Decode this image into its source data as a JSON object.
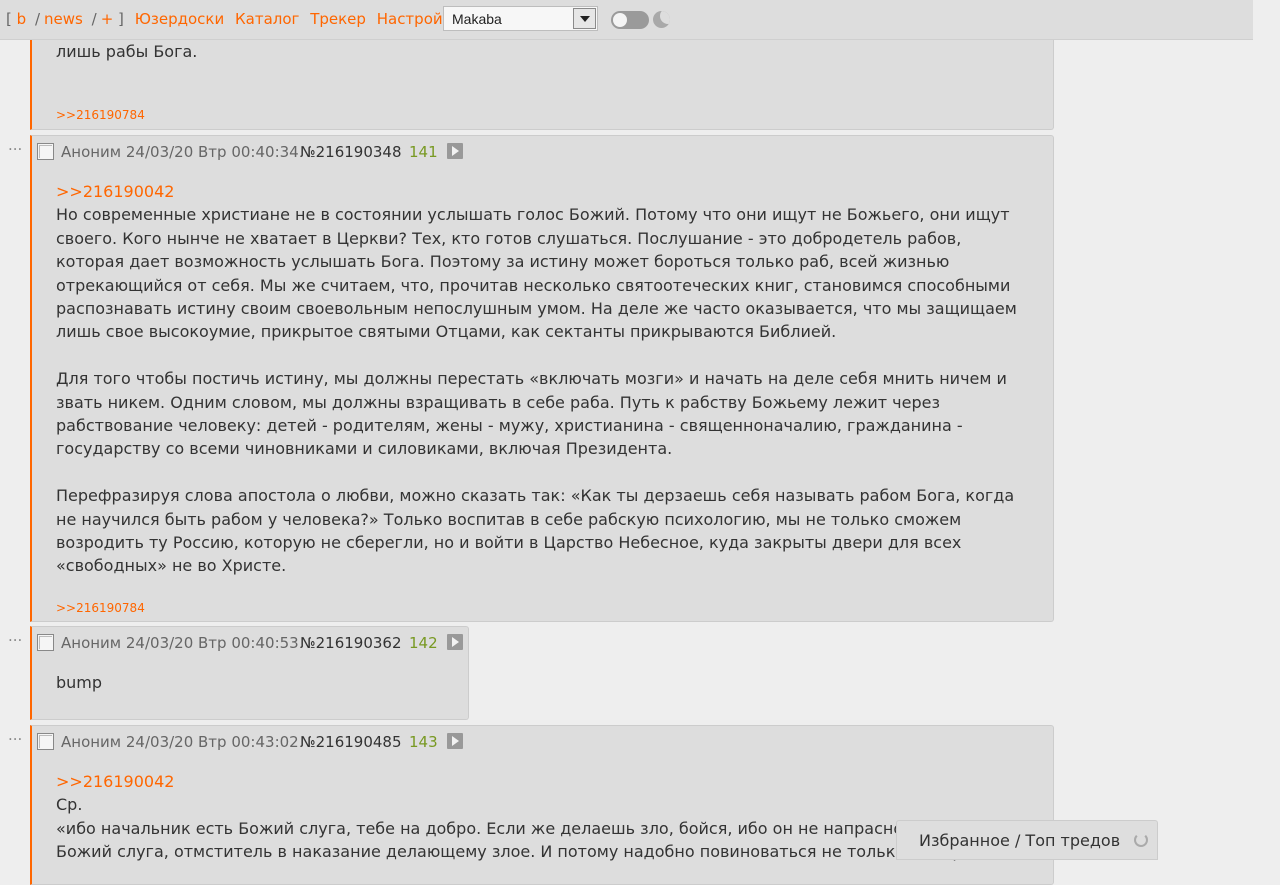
{
  "topbar": {
    "bracket_open": "[",
    "board_b": "b",
    "sep1": "/",
    "board_news": "news",
    "sep2": "/",
    "board_plus": "+",
    "bracket_close": "]",
    "menu": [
      "Юзердоски",
      "Каталог",
      "Трекер",
      "Настройки"
    ],
    "style_select": "Makaba"
  },
  "colors": {
    "accent": "#ff6600",
    "count": "#789922",
    "post_bg": "#dddddd"
  },
  "posts": [
    {
      "tail_text": "лишь рабы Бога.",
      "backlink": ">>216190784"
    },
    {
      "author": "Аноним 24/03/20 Втр 00:40:34",
      "num": "№216190348",
      "count": "141",
      "reply": ">>216190042",
      "paragraphs": [
        "Но современные христиане не в состоянии услышать голос Божий. Потому что они ищут не Божьего, они ищут своего. Кого нынче не хватает в Церкви? Тех, кто готов слушаться. Послушание - это добродетель рабов, которая дает возможность услышать Бога. Поэтому за истину может бороться только раб, всей жизнью отрекающийся от себя. Мы же считаем, что, прочитав несколько святоотеческих книг, становимся способными распознавать истину своим своевольным непослушным умом. На деле же часто оказывается, что мы защищаем лишь свое высокоумие, прикрытое святыми Отцами, как сектанты прикрываются Библией.",
        "Для того чтобы постичь истину, мы должны перестать «включать мозги» и начать на деле себя мнить ничем и звать никем. Одним словом, мы должны взращивать в себе раба. Путь к рабству Божьему лежит через рабствование человеку: детей - родителям, жены - мужу, христианина - священноначалию, гражданина - государству со всеми чиновниками и силовиками, включая Президента.",
        "Перефразируя слова апостола о любви, можно сказать так: «Как ты дерзаешь себя называть рабом Бога, когда не научился быть рабом у человека?» Только воспитав в себе рабскую психологию, мы не только сможем возродить ту Россию, которую не сберегли, но и войти в Царство Небесное, куда закрыты двери для всех «свободных» не во Христе."
      ],
      "backlink": ">>216190784"
    },
    {
      "author": "Аноним 24/03/20 Втр 00:40:53",
      "num": "№216190362",
      "count": "142",
      "text": "bump"
    },
    {
      "author": "Аноним 24/03/20 Втр 00:43:02",
      "num": "№216190485",
      "count": "143",
      "reply": ">>216190042",
      "line1": "Ср.",
      "line2": "«ибо начальник есть Божий слуга, тебе на добро. Если же делаешь зло, бойся, ибо он не напрасно носит меч: он",
      "line3": "Божий слуга, отмститель в наказание делающему злое. И потому надобно повиноваться не только из страха"
    }
  ],
  "dots": "...",
  "fav_panel": {
    "label": "Избранное / Топ тредов"
  }
}
